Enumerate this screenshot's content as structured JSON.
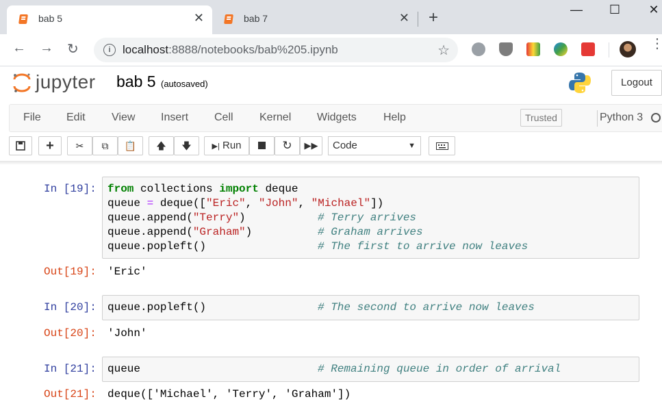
{
  "browser": {
    "tabs": [
      {
        "title": "bab 5",
        "active": true
      },
      {
        "title": "bab 7",
        "active": false
      }
    ],
    "url_host": "localhost",
    "url_rest": ":8888/notebooks/bab%205.ipynb",
    "window_controls": {
      "minimize": "—",
      "maximize": "☐",
      "close": "✕"
    }
  },
  "jupyter": {
    "logo_text": "jupyter",
    "notebook_name": "bab 5",
    "autosave_status": "(autosaved)",
    "logout_label": "Logout",
    "menu": [
      "File",
      "Edit",
      "View",
      "Insert",
      "Cell",
      "Kernel",
      "Widgets",
      "Help"
    ],
    "trusted_label": "Trusted",
    "kernel_name": "Python 3",
    "run_label": "Run",
    "cell_type": "Code",
    "accent": "#f37626"
  },
  "cells": [
    {
      "in_prompt": "In [19]:",
      "lines": [
        "from collections import deque",
        "queue = deque([\"Eric\", \"John\", \"Michael\"])",
        "queue.append(\"Terry\")",
        "queue.append(\"Graham\")",
        "queue.popleft()"
      ],
      "comments": [
        "",
        "",
        "# Terry arrives",
        "# Graham arrives",
        "# The first to arrive now leaves"
      ],
      "out_prompt": "Out[19]:",
      "output": "'Eric'"
    },
    {
      "in_prompt": "In [20]:",
      "lines": [
        "queue.popleft()"
      ],
      "comments": [
        "# The second to arrive now leaves"
      ],
      "out_prompt": "Out[20]:",
      "output": "'John'"
    },
    {
      "in_prompt": "In [21]:",
      "lines": [
        "queue"
      ],
      "comments": [
        "# Remaining queue in order of arrival"
      ],
      "out_prompt": "Out[21]:",
      "output": "deque(['Michael', 'Terry', 'Graham'])"
    }
  ]
}
